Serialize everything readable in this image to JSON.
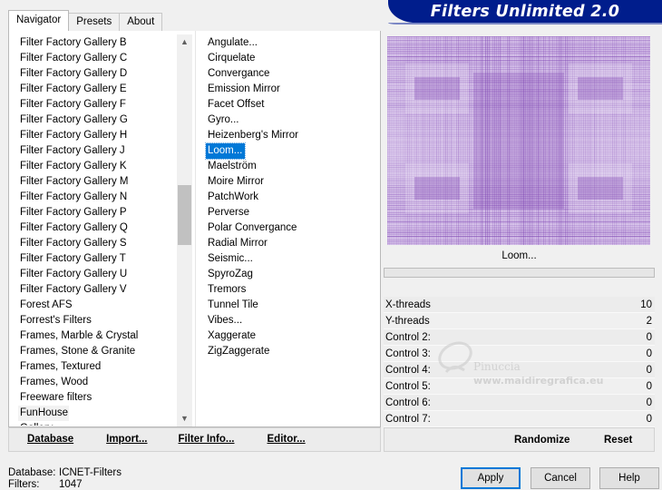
{
  "tabs": [
    "Navigator",
    "Presets",
    "About"
  ],
  "app_title": "Filters Unlimited 2.0",
  "categories": [
    "Filter Factory Gallery B",
    "Filter Factory Gallery C",
    "Filter Factory Gallery D",
    "Filter Factory Gallery E",
    "Filter Factory Gallery F",
    "Filter Factory Gallery G",
    "Filter Factory Gallery H",
    "Filter Factory Gallery J",
    "Filter Factory Gallery K",
    "Filter Factory Gallery M",
    "Filter Factory Gallery N",
    "Filter Factory Gallery P",
    "Filter Factory Gallery Q",
    "Filter Factory Gallery S",
    "Filter Factory Gallery T",
    "Filter Factory Gallery U",
    "Filter Factory Gallery V",
    "Forest AFS",
    "Forrest's Filters",
    "Frames, Marble & Crystal",
    "Frames, Stone & Granite",
    "Frames, Textured",
    "Frames, Wood",
    "Freeware filters",
    "FunHouse",
    "Gallery"
  ],
  "selected_category": "FunHouse",
  "filters": [
    "Angulate...",
    "Cirquelate",
    "Convergance",
    "Emission Mirror",
    "Facet Offset",
    "Gyro...",
    "Heizenberg's Mirror",
    "Loom...",
    "Maelström",
    "Moire Mirror",
    "PatchWork",
    "Perverse",
    "Polar Convergance",
    "Radial Mirror",
    "Seismic...",
    "SpyroZag",
    "Tremors",
    "Tunnel Tile",
    "Vibes...",
    "Xaggerate",
    "ZigZaggerate"
  ],
  "selected_filter": "Loom...",
  "preview_filter_name": "Loom...",
  "progress": 0,
  "controls": [
    {
      "label": "X-threads",
      "value": "10"
    },
    {
      "label": "Y-threads",
      "value": "2"
    },
    {
      "label": "Control 2:",
      "value": "0"
    },
    {
      "label": "Control 3:",
      "value": "0"
    },
    {
      "label": "Control 4:",
      "value": "0"
    },
    {
      "label": "Control 5:",
      "value": "0"
    },
    {
      "label": "Control 6:",
      "value": "0"
    },
    {
      "label": "Control 7:",
      "value": "0"
    }
  ],
  "bottom_buttons": {
    "database": "Database",
    "import": "Import...",
    "filter_info": "Filter Info...",
    "editor": "Editor...",
    "randomize": "Randomize",
    "reset": "Reset"
  },
  "status": {
    "database_label": "Database:",
    "database_value": "ICNET-Filters",
    "filters_label": "Filters:",
    "filters_value": "1047"
  },
  "dialog_buttons": {
    "apply": "Apply",
    "cancel": "Cancel",
    "help": "Help"
  },
  "watermark": {
    "name": "Pinuccia",
    "url": "www.maidiregrafica.eu"
  },
  "colors": {
    "banner": "#001d8c",
    "selection": "#0078d7",
    "preview_purple": "#7a3fb0",
    "progress_green": "#06b025"
  }
}
